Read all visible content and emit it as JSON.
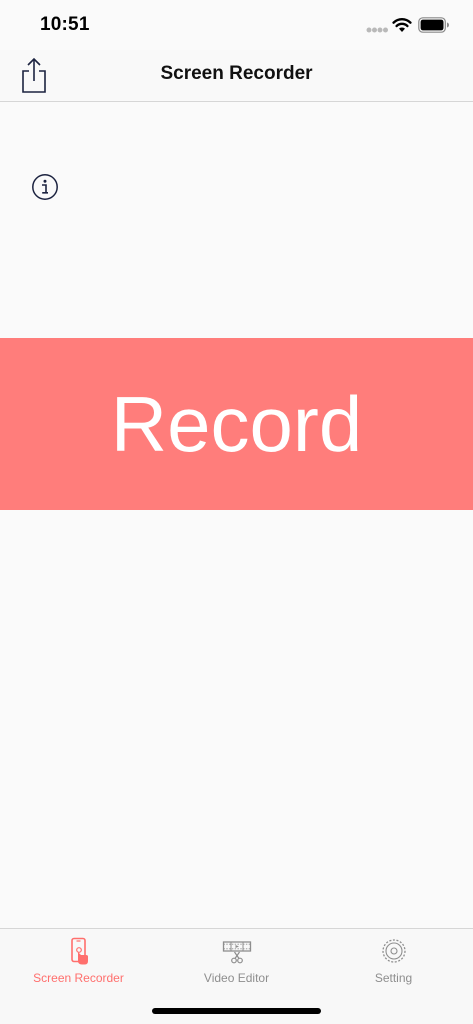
{
  "status_bar": {
    "time": "10:51"
  },
  "nav": {
    "title": "Screen Recorder",
    "share_icon": "share-icon"
  },
  "info_icon": "info-icon",
  "record": {
    "label": "Record",
    "color": "#ff7d7b"
  },
  "tabs": [
    {
      "label": "Screen Recorder",
      "icon": "phone-touch-icon",
      "active": true
    },
    {
      "label": "Video Editor",
      "icon": "film-scissors-icon",
      "active": false
    },
    {
      "label": "Setting",
      "icon": "gear-icon",
      "active": false
    }
  ],
  "colors": {
    "accent": "#ff6f6d",
    "inactive": "#8e8e8e",
    "icon_dark": "#1c2340"
  }
}
